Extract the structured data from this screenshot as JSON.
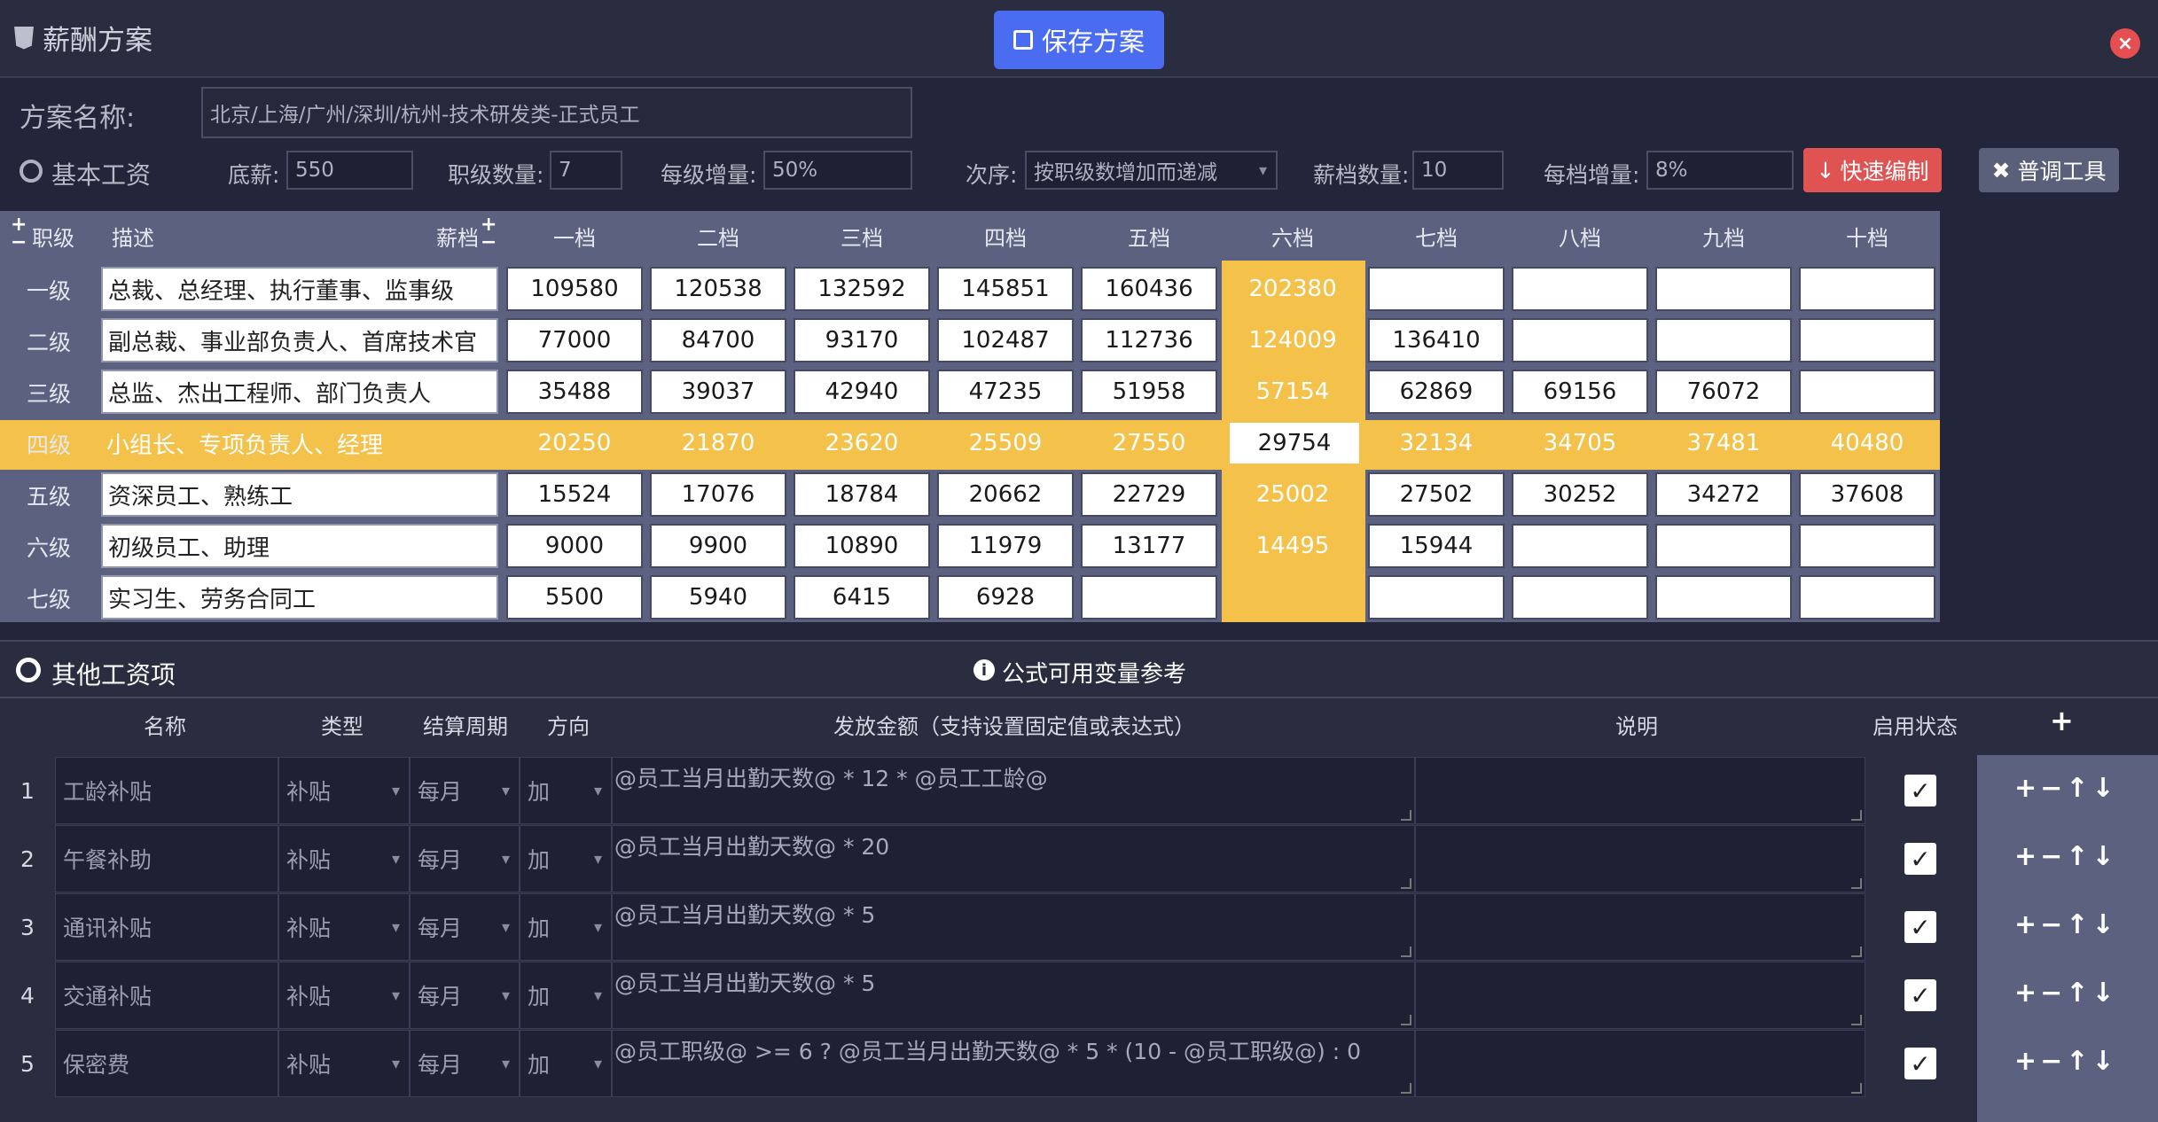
{
  "title": "薪酬方案",
  "save_label": "保存方案",
  "close_label": "×",
  "plan_label": "方案名称:",
  "plan_value": "北京/上海/广州/深圳/杭州-技术研发类-正式员工",
  "basic_label": "基本工资",
  "base_label": "底薪:",
  "base_value": "550",
  "grade_count_label": "职级数量:",
  "grade_count_value": "7",
  "grade_inc_label": "每级增量:",
  "grade_inc_value": "50%",
  "order_label": "次序:",
  "order_value": "按职级数增加而递减",
  "step_count_label": "薪档数量:",
  "step_count_value": "10",
  "step_inc_label": "每档增量:",
  "step_inc_value": "8%",
  "quick_label": "快速编制",
  "tools_label": "普调工具",
  "grade_header": "职级",
  "desc_header": "描述",
  "step_header": "薪档",
  "steps": [
    "一档",
    "二档",
    "三档",
    "四档",
    "五档",
    "六档",
    "七档",
    "八档",
    "九档",
    "十档"
  ],
  "grades": [
    {
      "name": "一级",
      "desc": "总裁、总经理、执行董事、监事级",
      "values": [
        "109580",
        "120538",
        "132592",
        "145851",
        "160436",
        "202380",
        "",
        "",
        "",
        ""
      ]
    },
    {
      "name": "二级",
      "desc": "副总裁、事业部负责人、首席技术官",
      "values": [
        "77000",
        "84700",
        "93170",
        "102487",
        "112736",
        "124009",
        "136410",
        "",
        "",
        ""
      ]
    },
    {
      "name": "三级",
      "desc": "总监、杰出工程师、部门负责人",
      "values": [
        "35488",
        "39037",
        "42940",
        "47235",
        "51958",
        "57154",
        "62869",
        "69156",
        "76072",
        ""
      ]
    },
    {
      "name": "四级",
      "desc": "小组长、专项负责人、经理",
      "values": [
        "20250",
        "21870",
        "23620",
        "25509",
        "27550",
        "29754",
        "32134",
        "34705",
        "37481",
        "40480"
      ]
    },
    {
      "name": "五级",
      "desc": "资深员工、熟练工",
      "values": [
        "15524",
        "17076",
        "18784",
        "20662",
        "22729",
        "25002",
        "27502",
        "30252",
        "34272",
        "37608"
      ]
    },
    {
      "name": "六级",
      "desc": "初级员工、助理",
      "values": [
        "9000",
        "9900",
        "10890",
        "11979",
        "13177",
        "14495",
        "15944",
        "",
        "",
        ""
      ]
    },
    {
      "name": "七级",
      "desc": "实习生、劳务合同工",
      "values": [
        "5500",
        "5940",
        "6415",
        "6928",
        "",
        "",
        "",
        "",
        "",
        ""
      ]
    }
  ],
  "other_label": "其他工资项",
  "formula_ref_label": "公式可用变量参考",
  "bottom_headers": {
    "name": "名称",
    "type": "类型",
    "period": "结算周期",
    "direction": "方向",
    "amount": "发放金额（支持设置固定值或表达式）",
    "note": "说明",
    "status": "启用状态",
    "add": "+"
  },
  "items": [
    {
      "no": "1",
      "name": "工龄补贴",
      "type": "补贴",
      "period": "每月",
      "dir": "加",
      "formula": "@员工当月出勤天数@ * 12 * @员工工龄@"
    },
    {
      "no": "2",
      "name": "午餐补助",
      "type": "补贴",
      "period": "每月",
      "dir": "加",
      "formula": "@员工当月出勤天数@ * 20"
    },
    {
      "no": "3",
      "name": "通讯补贴",
      "type": "补贴",
      "period": "每月",
      "dir": "加",
      "formula": "@员工当月出勤天数@ * 5"
    },
    {
      "no": "4",
      "name": "交通补贴",
      "type": "补贴",
      "period": "每月",
      "dir": "加",
      "formula": "@员工当月出勤天数@ * 5"
    },
    {
      "no": "5",
      "name": "保密费",
      "type": "补贴",
      "period": "每月",
      "dir": "加",
      "formula": "@员工职级@ >= 6 ? @员工当月出勤天数@ * 5 * (10 - @员工职级@) : 0"
    }
  ],
  "ops_label": "+−↑↓"
}
